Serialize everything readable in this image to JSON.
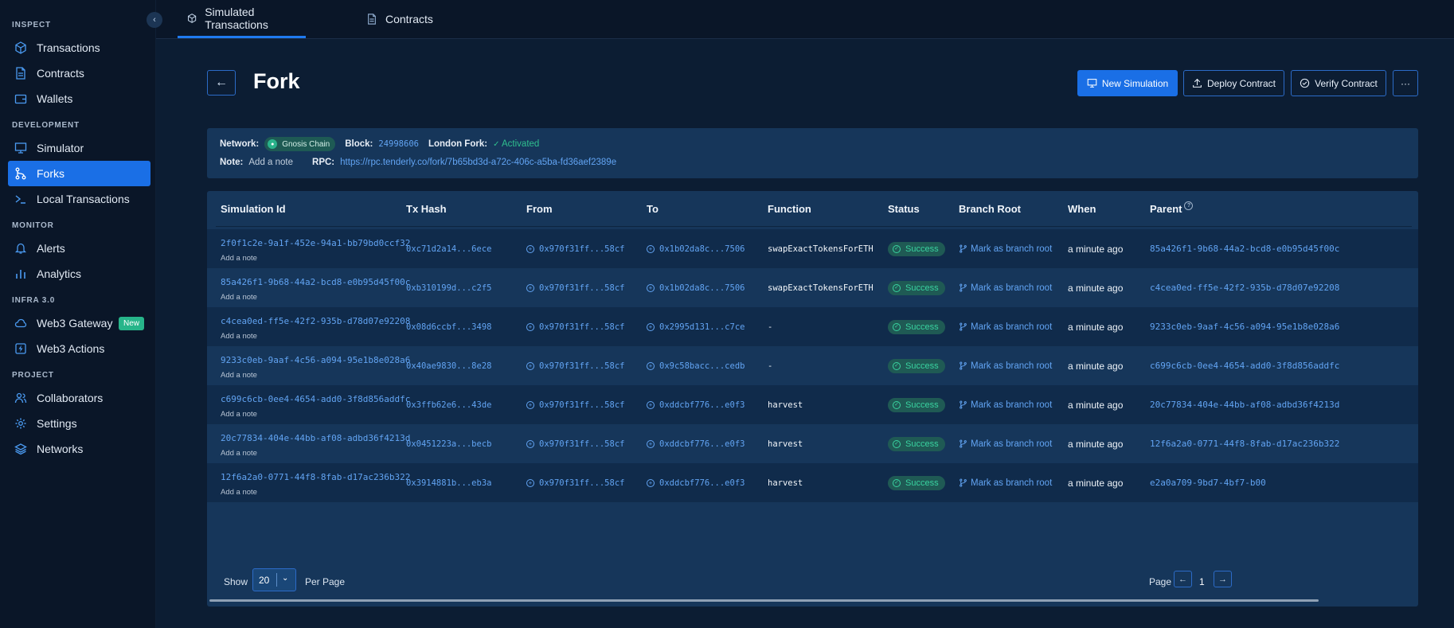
{
  "sidebar": {
    "sections": [
      {
        "title": "INSPECT",
        "items": [
          {
            "label": "Transactions",
            "icon": "cube-icon"
          },
          {
            "label": "Contracts",
            "icon": "file-icon"
          },
          {
            "label": "Wallets",
            "icon": "wallet-icon"
          }
        ]
      },
      {
        "title": "DEVELOPMENT",
        "items": [
          {
            "label": "Simulator",
            "icon": "monitor-icon"
          },
          {
            "label": "Forks",
            "icon": "fork-icon",
            "active": true
          },
          {
            "label": "Local Transactions",
            "icon": "terminal-icon"
          }
        ]
      },
      {
        "title": "MONITOR",
        "items": [
          {
            "label": "Alerts",
            "icon": "bell-icon"
          },
          {
            "label": "Analytics",
            "icon": "chart-icon"
          }
        ]
      },
      {
        "title": "INFRA 3.0",
        "items": [
          {
            "label": "Web3 Gateway",
            "icon": "cloud-icon",
            "badge": "New"
          },
          {
            "label": "Web3 Actions",
            "icon": "lightning-icon"
          }
        ]
      },
      {
        "title": "PROJECT",
        "items": [
          {
            "label": "Collaborators",
            "icon": "users-icon"
          },
          {
            "label": "Settings",
            "icon": "gear-icon"
          },
          {
            "label": "Networks",
            "icon": "layers-icon"
          }
        ]
      }
    ]
  },
  "tabs": [
    {
      "label": "Simulated Transactions",
      "active": true
    },
    {
      "label": "Contracts",
      "active": false
    }
  ],
  "header": {
    "title": "Fork",
    "new_simulation": "New Simulation",
    "deploy_contract": "Deploy Contract",
    "verify_contract": "Verify Contract",
    "more": "···"
  },
  "info": {
    "network_label": "Network:",
    "network_value": "Gnosis Chain",
    "block_label": "Block:",
    "block_value": "24998606",
    "london_label": "London Fork:",
    "london_value": "Activated",
    "note_label": "Note:",
    "note_value": "Add a note",
    "rpc_label": "RPC:",
    "rpc_value": "https://rpc.tenderly.co/fork/7b65bd3d-a72c-406c-a5ba-fd36aef2389e"
  },
  "table": {
    "headers": [
      "Simulation Id",
      "Tx Hash",
      "From",
      "To",
      "Function",
      "Status",
      "Branch Root",
      "When",
      "Parent"
    ],
    "add_note": "Add a note",
    "branch_label": "Mark as branch root",
    "rows": [
      {
        "id": "2f0f1c2e-9a1f-452e-94a1-bb79bd0ccf32",
        "tx": "0xc71d2a14...6ece",
        "from": "0x970f31ff...58cf",
        "to": "0x1b02da8c...7506",
        "fn": "swapExactTokensForETH",
        "status": "Success",
        "when": "a minute ago",
        "parent": "85a426f1-9b68-44a2-bcd8-e0b95d45f00c"
      },
      {
        "id": "85a426f1-9b68-44a2-bcd8-e0b95d45f00c",
        "tx": "0xb310199d...c2f5",
        "from": "0x970f31ff...58cf",
        "to": "0x1b02da8c...7506",
        "fn": "swapExactTokensForETH",
        "status": "Success",
        "when": "a minute ago",
        "parent": "c4cea0ed-ff5e-42f2-935b-d78d07e92208"
      },
      {
        "id": "c4cea0ed-ff5e-42f2-935b-d78d07e92208",
        "tx": "0x08d6ccbf...3498",
        "from": "0x970f31ff...58cf",
        "to": "0x2995d131...c7ce",
        "fn": "-",
        "status": "Success",
        "when": "a minute ago",
        "parent": "9233c0eb-9aaf-4c56-a094-95e1b8e028a6"
      },
      {
        "id": "9233c0eb-9aaf-4c56-a094-95e1b8e028a6",
        "tx": "0x40ae9830...8e28",
        "from": "0x970f31ff...58cf",
        "to": "0x9c58bacc...cedb",
        "fn": "-",
        "status": "Success",
        "when": "a minute ago",
        "parent": "c699c6cb-0ee4-4654-add0-3f8d856addfc"
      },
      {
        "id": "c699c6cb-0ee4-4654-add0-3f8d856addfc",
        "tx": "0x3ffb62e6...43de",
        "from": "0x970f31ff...58cf",
        "to": "0xddcbf776...e0f3",
        "fn": "harvest",
        "status": "Success",
        "when": "a minute ago",
        "parent": "20c77834-404e-44bb-af08-adbd36f4213d"
      },
      {
        "id": "20c77834-404e-44bb-af08-adbd36f4213d",
        "tx": "0x0451223a...becb",
        "from": "0x970f31ff...58cf",
        "to": "0xddcbf776...e0f3",
        "fn": "harvest",
        "status": "Success",
        "when": "a minute ago",
        "parent": "12f6a2a0-0771-44f8-8fab-d17ac236b322"
      },
      {
        "id": "12f6a2a0-0771-44f8-8fab-d17ac236b322",
        "tx": "0x3914881b...eb3a",
        "from": "0x970f31ff...58cf",
        "to": "0xddcbf776...e0f3",
        "fn": "harvest",
        "status": "Success",
        "when": "a minute ago",
        "parent": "e2a0a709-9bd7-4bf7-b00"
      }
    ]
  },
  "pagination": {
    "show_label": "Show",
    "per_page_value": "20",
    "per_page_label": "Per Page",
    "page_label": "Page",
    "current_page": "1"
  },
  "colors": {
    "accent": "#1a6fe6",
    "link": "#62a4f3",
    "success": "#39d3a0",
    "bg": "#0c1d33",
    "card": "#16365a"
  }
}
